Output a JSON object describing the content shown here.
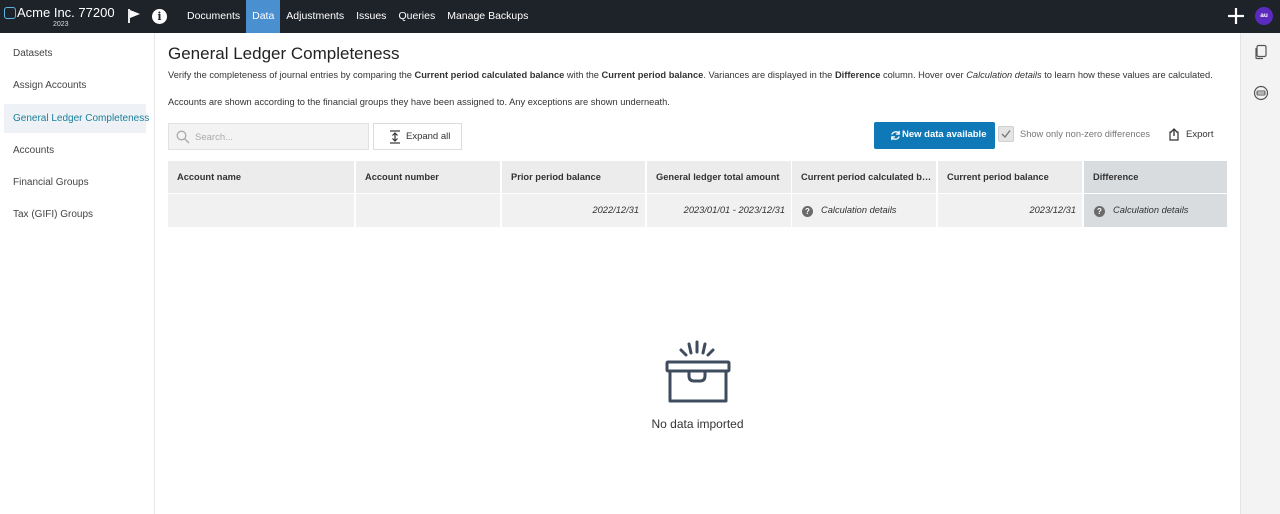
{
  "app": {
    "company": "Acme Inc. 77200",
    "year": "2023",
    "nav": [
      "Documents",
      "Data",
      "Adjustments",
      "Issues",
      "Queries",
      "Manage Backups"
    ],
    "active_nav": "Data",
    "avatar_initials": "au",
    "icons": {
      "flag": "flag-icon",
      "info": "info-icon",
      "add": "plus-icon"
    },
    "colors": {
      "topbar": "#1e2329",
      "active_nav": "#4a8fd0",
      "primary_button": "#0f79b8",
      "avatar": "#5b2bc0",
      "active_sidebar_text": "#1a7f9b"
    }
  },
  "sidebar": {
    "items": [
      "Datasets",
      "Assign Accounts",
      "General Ledger Completeness",
      "Accounts",
      "Financial Groups",
      "Tax (GIFI) Groups"
    ],
    "active": "General Ledger Completeness"
  },
  "page": {
    "title": "General Ledger Completeness",
    "description": {
      "p1": "Verify the completeness of journal entries by comparing the ",
      "b1": "Current period calculated balance",
      "p2": " with the ",
      "b2": "Current period balance",
      "p3": ". Variances are displayed in the ",
      "b3": "Difference",
      "p4": " column. Hover over ",
      "i1": "Calculation details",
      "p5": " to learn how these values are calculated."
    },
    "groups_note": "Accounts are shown according to the financial groups they have been assigned to. Any exceptions are shown underneath."
  },
  "toolbar": {
    "search_placeholder": "Search...",
    "search_value": "",
    "expand_all": "Expand all",
    "new_data": "New data available",
    "show_nonzero": "Show only non-zero differences",
    "show_nonzero_checked": true,
    "export": "Export"
  },
  "table": {
    "columns": [
      "Account name",
      "Account number",
      "Prior period balance",
      "General ledger total amount",
      "Current period calculated bala...",
      "Current period balance",
      "Difference"
    ],
    "subheader": [
      "",
      "",
      "2022/12/31",
      "2023/01/01 - 2023/12/31",
      "Calculation details",
      "2023/12/31",
      "Calculation details"
    ]
  },
  "empty_state": {
    "icon": "empty-box-icon",
    "text": "No data imported"
  },
  "right_rail": {
    "icons": [
      "copy-icon",
      "api-icon"
    ]
  }
}
